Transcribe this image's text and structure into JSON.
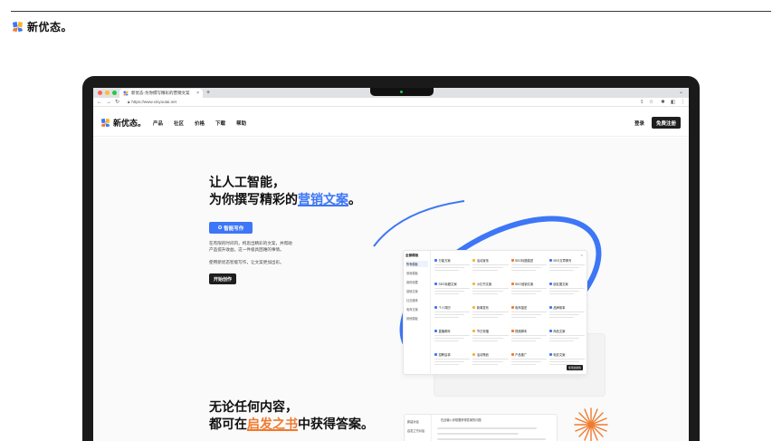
{
  "brand": {
    "name": "新优态。",
    "colors": {
      "blue": "#3d76f6",
      "orange": "#f07a2e",
      "dark": "#1e1e1e"
    }
  },
  "browser": {
    "tab_title": "新优态-为你撰写精彩的营销文案",
    "tab_close": "×",
    "new_tab": "+",
    "url": "https://www.xinyoutai.net",
    "nav_icons": [
      "back-arrow-icon",
      "forward-arrow-icon",
      "reload-icon"
    ]
  },
  "site": {
    "menu": [
      "产品",
      "社区",
      "价格",
      "下载",
      "帮助"
    ],
    "login": "登录",
    "signup": "免费注册"
  },
  "hero": {
    "headline_line1": "让人工智能，",
    "headline_line2_prefix": "为你撰写精彩的",
    "headline_highlight": "营销文案",
    "headline_suffix": "。",
    "ai_button": "智能写作",
    "desc_line1": "在有限的时间内，构思出精彩的文案，并帮助",
    "desc_line2": "产品提升收益。这一件极具困难的事情。",
    "desc_line3": "使用新优态智能写作，让文案更加出彩。",
    "start_button": "开始创作"
  },
  "modal": {
    "title": "全部模板",
    "close": "×",
    "side_items": [
      "所有模板",
      "常用模板",
      "我的收藏",
      "营销文案",
      "社交媒体",
      "电商文案",
      "其他模板"
    ],
    "cells": [
      "万能方案",
      "活动宣传",
      "SEO标题描述",
      "SEO文章撰写",
      "SEO标题文案",
      "小红书文案",
      "SEO营销文案",
      "朋友圈文案",
      "个人简历",
      "新闻发布",
      "电商描述",
      "品牌故事",
      "直播脚本",
      "节日祝福",
      "视频脚本",
      "商品文案",
      "招聘启事",
      "活动策划",
      "产品推广",
      "电影文案"
    ],
    "button": "使用此模板"
  },
  "section2": {
    "headline_line1": "无论任何内容，",
    "headline_line2_prefix": "都可在",
    "headline_highlight": "启发之书",
    "headline_suffix": "中获得答案。",
    "preview_side": [
      "新建对话",
      "启发之书对话"
    ],
    "preview_text": "在此输入你想要获得答案的问题"
  }
}
